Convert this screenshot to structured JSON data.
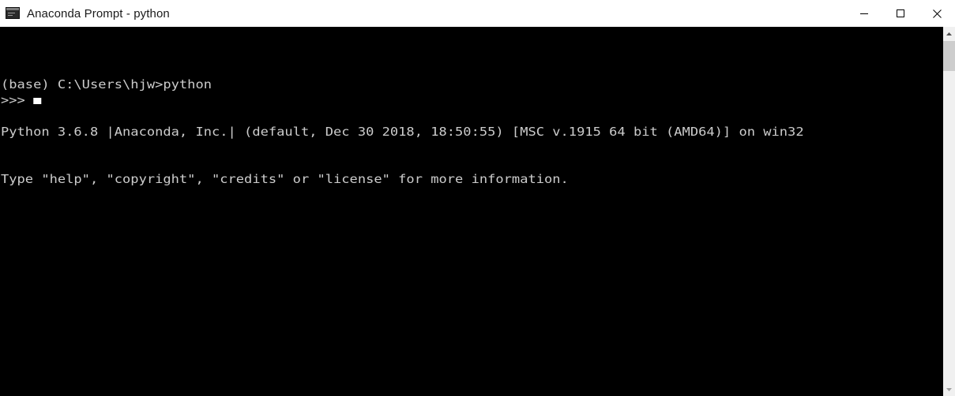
{
  "window": {
    "title": "Anaconda Prompt - python",
    "icon": "console-window-icon",
    "background_color": "#000000",
    "titlebar_color": "#ffffff"
  },
  "window_controls": {
    "minimize_label": "—",
    "maximize_label": "☐",
    "close_label": "✕",
    "minimize_name": "minimize-button",
    "maximize_name": "maximize-button",
    "close_name": "close-button"
  },
  "terminal": {
    "foreground_color": "#cccccc",
    "lines": [
      "(base) C:\\Users\\hjw>python",
      "Python 3.6.8 |Anaconda, Inc.| (default, Dec 30 2018, 18:50:55) [MSC v.1915 64 bit (AMD64)] on win32",
      "Type \"help\", \"copyright\", \"credits\" or \"license\" for more information."
    ],
    "prompt": ">>> ",
    "cursor": "block-cursor",
    "cursor_visible": true
  },
  "scrollbar": {
    "up_arrow": "scroll-up-arrow",
    "down_arrow": "scroll-down-arrow",
    "track_color": "#f0f0f0",
    "thumb_color": "#cdcdcd"
  }
}
